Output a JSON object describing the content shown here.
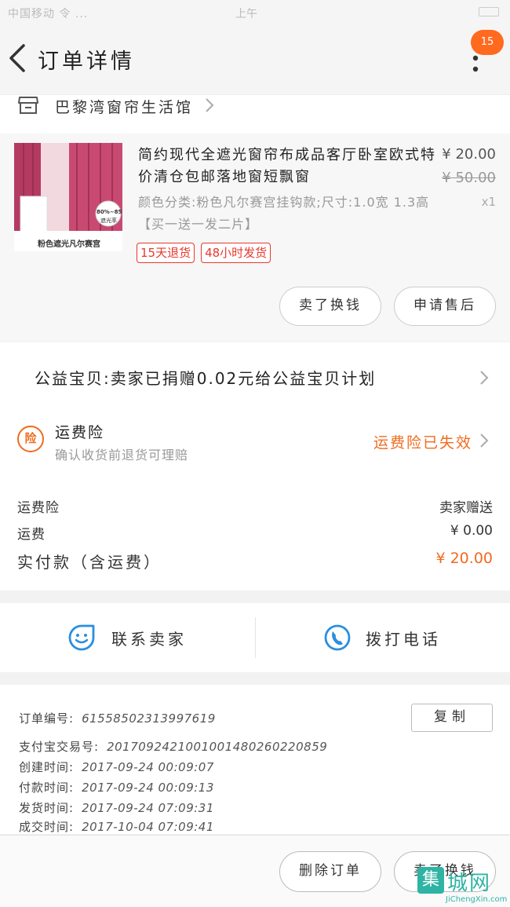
{
  "status_bar": {
    "left": "中国移动 令 ...",
    "time": "上午"
  },
  "header": {
    "title": "订单详情",
    "badge": "15"
  },
  "shop": {
    "name": "巴黎湾窗帘生活馆"
  },
  "product": {
    "name": "简约现代全遮光窗帘布成品客厅卧室欧式特价清仓包邮落地窗短飘窗",
    "price": "¥ 20.00",
    "original_price": "¥ 50.00",
    "quantity": "x1",
    "sku": "颜色分类:粉色凡尔赛宫挂钩款;尺寸:1.0宽 1.3高【买一送一发二片】",
    "thumb_caption": "粉色遮光凡尔赛宫",
    "thumb_badge_1": "80%~85%",
    "thumb_badge_2": "遮光率",
    "tags": [
      "15天退货",
      "48小时发货"
    ],
    "buttons": {
      "buy_again": "卖了换钱",
      "after_sale": "申请售后"
    }
  },
  "charity": {
    "text": "公益宝贝:卖家已捐赠0.02元给公益宝贝计划"
  },
  "insurance": {
    "icon_char": "险",
    "title": "运费险",
    "subtitle": "确认收货前退货可理赔",
    "status": "运费险已失效"
  },
  "fees": {
    "rows": [
      {
        "label": "运费险",
        "value": "卖家赠送"
      },
      {
        "label": "运费",
        "value": "¥ 0.00"
      }
    ],
    "total": {
      "label": "实付款（含运费）",
      "value": "¥ 20.00"
    }
  },
  "contact": {
    "seller": "联系卖家",
    "call": "拨打电话"
  },
  "order_info": {
    "order_no": {
      "label": "订单编号:",
      "value": "61558502313997619"
    },
    "alipay_no": {
      "label": "支付宝交易号:",
      "value": "2017092421001001480260220859"
    },
    "created": {
      "label": "创建时间:",
      "value": "2017-09-24 00:09:07"
    },
    "paid": {
      "label": "付款时间:",
      "value": "2017-09-24 00:09:13"
    },
    "shipped": {
      "label": "发货时间:",
      "value": "2017-09-24 07:09:31"
    },
    "completed": {
      "label": "成交时间:",
      "value": "2017-10-04 07:09:41"
    },
    "copy_label": "复制"
  },
  "bottom_bar": {
    "delete": "删除订单",
    "sell": "卖了换钱"
  },
  "watermark": {
    "box": "集",
    "cn": "城网",
    "en": "JiChengXin.com"
  },
  "colors": {
    "accent": "#f06b1f",
    "blue": "#2a8fe0",
    "red_tag": "#e8382e",
    "badge": "#ff6a1f"
  }
}
